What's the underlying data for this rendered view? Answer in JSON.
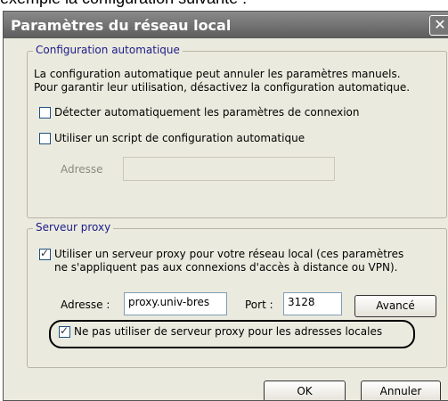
{
  "caption": "exemple la configuration suivante :",
  "window": {
    "title": "Paramètres du réseau local",
    "close_glyph": "✕"
  },
  "auto_config": {
    "legend": "Configuration automatique",
    "description_line1": "La configuration automatique peut annuler les paramètres manuels.",
    "description_line2": "Pour garantir leur utilisation, désactivez la configuration automatique.",
    "detect_label": "Détecter automatiquement les paramètres de connexion",
    "detect_checked": false,
    "script_label": "Utiliser un script de configuration automatique",
    "script_checked": false,
    "address_label": "Adresse",
    "address_value": ""
  },
  "proxy": {
    "legend": "Serveur proxy",
    "use_proxy_line1": "Utiliser un serveur proxy pour votre réseau local (ces paramètres",
    "use_proxy_line2": "ne s'appliquent pas aux connexions d'accès à distance ou VPN).",
    "use_proxy_checked": true,
    "address_label": "Adresse :",
    "address_value": "proxy.univ-bres",
    "port_label": "Port :",
    "port_value": "3128",
    "advanced_label": "Avancé",
    "bypass_label": "Ne pas utiliser de serveur proxy pour les adresses locales",
    "bypass_checked": true
  },
  "buttons": {
    "ok_label": "OK",
    "cancel_label": "Annuler"
  }
}
